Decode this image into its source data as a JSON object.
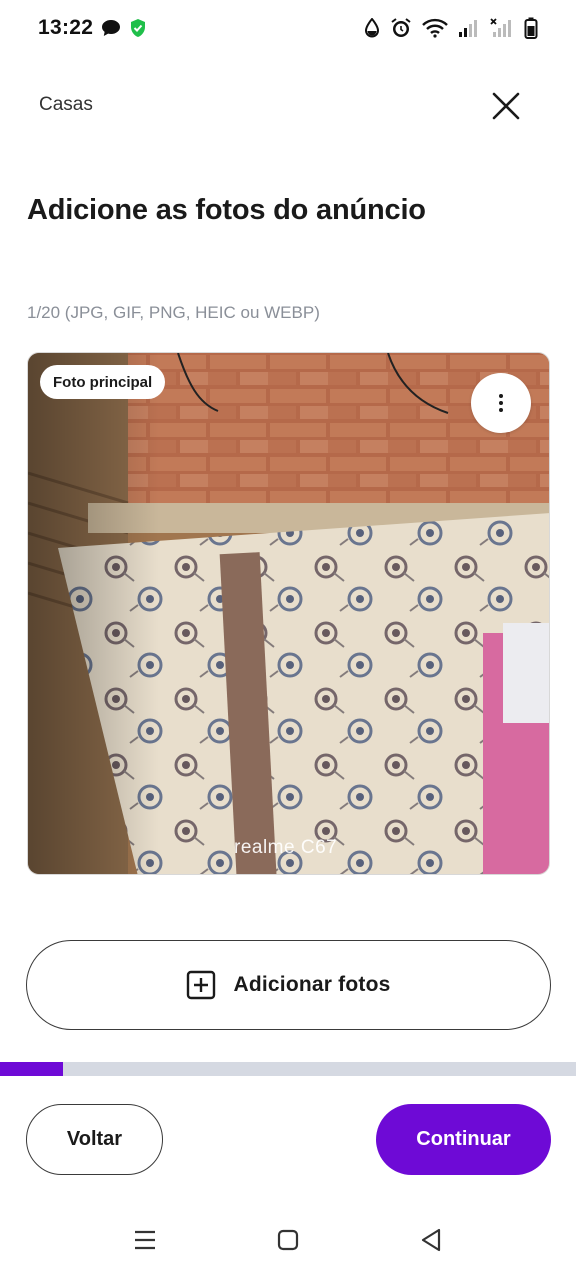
{
  "status_bar": {
    "time": "13:22",
    "left_icons": [
      "chat-bubble-icon",
      "shield-check-icon"
    ],
    "right_icons": [
      "water-drop-icon",
      "alarm-icon",
      "wifi-icon",
      "signal-icon",
      "signal-no-service-icon",
      "battery-icon"
    ]
  },
  "header": {
    "breadcrumb": "Casas",
    "close_icon": "close-icon"
  },
  "page": {
    "title": "Adicione as fotos do anúncio",
    "photo_hint": "1/20 (JPG, GIF, PNG, HEIC ou WEBP)"
  },
  "photo": {
    "badge": "Foto principal",
    "more_icon": "more-vertical-icon",
    "watermark": "realme C67"
  },
  "actions": {
    "add_photos_label": "Adicionar fotos",
    "add_icon": "plus-square-icon",
    "back_label": "Voltar",
    "continue_label": "Continuar"
  },
  "progress": {
    "fraction": 0.11
  },
  "nav_bar": {
    "icons": [
      "menu-icon",
      "home-square-icon",
      "back-triangle-icon"
    ]
  },
  "colors": {
    "accent": "#6e0ad6",
    "progress_track": "#d5d9e2",
    "hint_text": "#8a8f98"
  }
}
